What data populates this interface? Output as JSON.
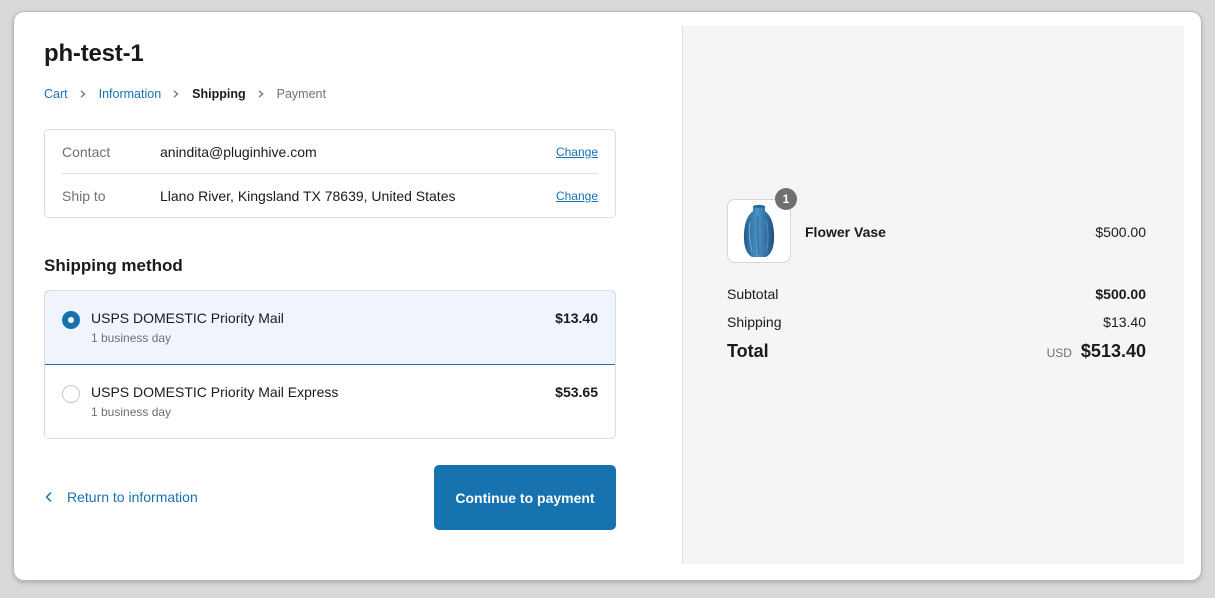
{
  "store": {
    "title": "ph-test-1"
  },
  "breadcrumb": {
    "cart": "Cart",
    "information": "Information",
    "shipping": "Shipping",
    "payment": "Payment"
  },
  "review": {
    "contact_label": "Contact",
    "contact_value": "anindita@pluginhive.com",
    "ship_to_label": "Ship to",
    "ship_to_value": "Llano River, Kingsland TX 78639, United States",
    "change_label": "Change"
  },
  "shipping_method": {
    "title": "Shipping method",
    "options": [
      {
        "name": "USPS DOMESTIC Priority Mail",
        "eta": "1 business day",
        "price": "$13.40",
        "selected": true
      },
      {
        "name": "USPS DOMESTIC Priority Mail Express",
        "eta": "1 business day",
        "price": "$53.65",
        "selected": false
      }
    ]
  },
  "actions": {
    "return_label": "Return to information",
    "continue_label": "Continue to payment"
  },
  "summary": {
    "product": {
      "name": "Flower Vase",
      "price": "$500.00",
      "quantity": "1"
    },
    "subtotal_label": "Subtotal",
    "subtotal_value": "$500.00",
    "shipping_label": "Shipping",
    "shipping_value": "$13.40",
    "total_label": "Total",
    "currency": "USD",
    "total_value": "$513.40"
  },
  "colors": {
    "accent": "#1773b0",
    "selected_bg": "#f0f5fd",
    "summary_bg": "#f5f5f5",
    "vase": "#3b7fb5"
  }
}
